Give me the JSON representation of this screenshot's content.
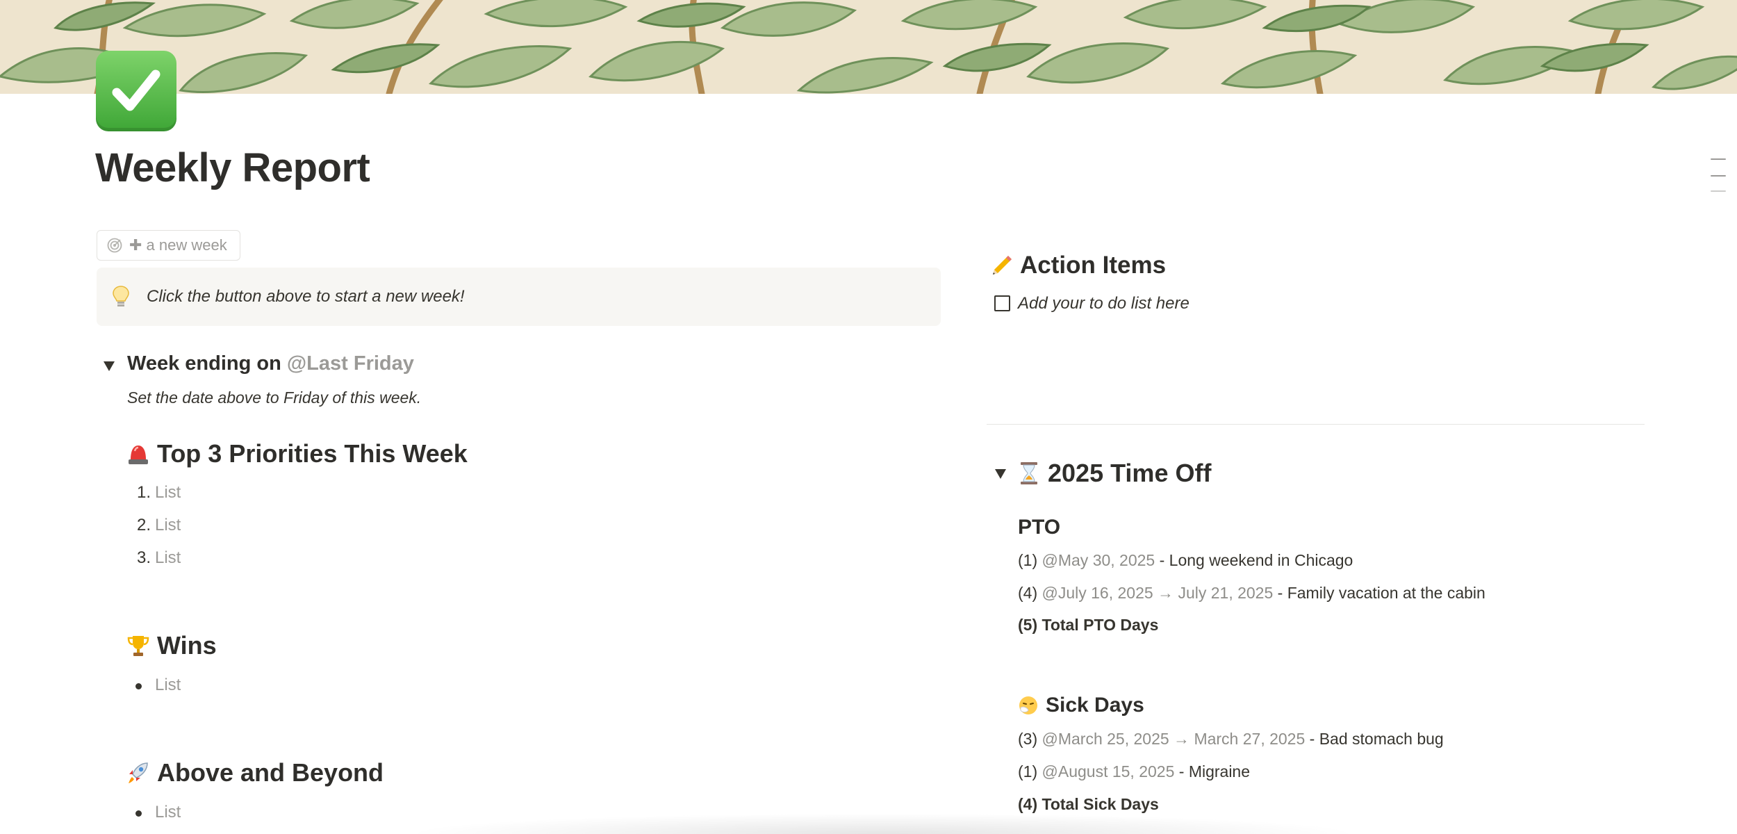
{
  "page": {
    "title": "Weekly Report"
  },
  "template_button": {
    "label": "✚ a new week"
  },
  "callout": {
    "text": "Click the button above to start a new week!"
  },
  "week": {
    "heading_prefix": "Week ending on ",
    "mention": "@Last Friday",
    "subtext": "Set the date above to Friday of this week."
  },
  "sections": {
    "priorities": {
      "title": "Top 3 Priorities This Week",
      "items": [
        {
          "num": "1.",
          "text": "List"
        },
        {
          "num": "2.",
          "text": "List"
        },
        {
          "num": "3.",
          "text": "List"
        }
      ]
    },
    "wins": {
      "title": "Wins",
      "items": [
        "List"
      ]
    },
    "above": {
      "title": "Above and Beyond",
      "items": [
        "List"
      ]
    }
  },
  "action_items": {
    "title": "Action Items",
    "todo": "Add your to do list here",
    "checked": false
  },
  "time_off": {
    "title": "2025 Time Off",
    "pto": {
      "title": "PTO",
      "entries": [
        {
          "count": "(1) ",
          "date": "@May 30, 2025",
          "desc": " - Long weekend in Chicago"
        },
        {
          "count": "(4) ",
          "date": "@July 16, 2025 → July 21, 2025",
          "desc": " - Family vacation at the cabin"
        }
      ],
      "total": "(5) Total PTO Days"
    },
    "sick": {
      "title": "Sick Days",
      "entries": [
        {
          "count": "(3) ",
          "date": "@March 25, 2025 → March 27, 2025",
          "desc": " - Bad stomach bug"
        },
        {
          "count": "(1) ",
          "date": "@August 15, 2025",
          "desc": " - Migraine"
        }
      ],
      "total": "(4) Total Sick Days"
    }
  },
  "colors": {
    "text": "#37352f",
    "muted": "#9b9a97",
    "callout_bg": "#f7f6f3",
    "icon_green": "#3ea636",
    "cover_bg": "#eee4ce"
  },
  "icons": [
    "check-mark-button-icon",
    "target-icon",
    "light-bulb-icon",
    "pencil-icon",
    "siren-icon",
    "trophy-icon",
    "rocket-icon",
    "hourglass-icon",
    "sneezing-face-icon",
    "outline-icon"
  ]
}
